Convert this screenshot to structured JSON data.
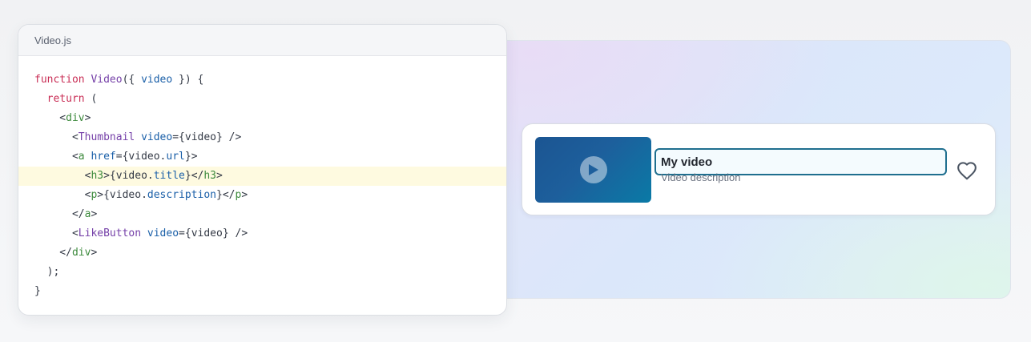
{
  "editor": {
    "filename": "Video.js",
    "highlighted_line": 5,
    "lines": [
      [
        {
          "t": "function ",
          "c": "kw"
        },
        {
          "t": "Video",
          "c": "fn"
        },
        {
          "t": "({ ",
          "c": "plain"
        },
        {
          "t": "video",
          "c": "prop"
        },
        {
          "t": " }) {",
          "c": "plain"
        }
      ],
      [
        {
          "t": "  return ",
          "c": "kw"
        },
        {
          "t": "(",
          "c": "plain"
        }
      ],
      [
        {
          "t": "    <",
          "c": "plain"
        },
        {
          "t": "div",
          "c": "tag"
        },
        {
          "t": ">",
          "c": "plain"
        }
      ],
      [
        {
          "t": "      <",
          "c": "plain"
        },
        {
          "t": "Thumbnail",
          "c": "comp"
        },
        {
          "t": " video",
          "c": "prop"
        },
        {
          "t": "={video} />",
          "c": "plain"
        }
      ],
      [
        {
          "t": "      <",
          "c": "plain"
        },
        {
          "t": "a",
          "c": "tag"
        },
        {
          "t": " href",
          "c": "prop"
        },
        {
          "t": "={video.",
          "c": "plain"
        },
        {
          "t": "url",
          "c": "prop"
        },
        {
          "t": "}>",
          "c": "plain"
        }
      ],
      [
        {
          "t": "        <",
          "c": "plain"
        },
        {
          "t": "h3",
          "c": "tag"
        },
        {
          "t": ">{video.",
          "c": "plain"
        },
        {
          "t": "title",
          "c": "prop"
        },
        {
          "t": "}</",
          "c": "plain"
        },
        {
          "t": "h3",
          "c": "tag"
        },
        {
          "t": ">",
          "c": "plain"
        }
      ],
      [
        {
          "t": "        <",
          "c": "plain"
        },
        {
          "t": "p",
          "c": "tag"
        },
        {
          "t": ">{video.",
          "c": "plain"
        },
        {
          "t": "description",
          "c": "prop"
        },
        {
          "t": "}</",
          "c": "plain"
        },
        {
          "t": "p",
          "c": "tag"
        },
        {
          "t": ">",
          "c": "plain"
        }
      ],
      [
        {
          "t": "      </",
          "c": "plain"
        },
        {
          "t": "a",
          "c": "tag"
        },
        {
          "t": ">",
          "c": "plain"
        }
      ],
      [
        {
          "t": "      <",
          "c": "plain"
        },
        {
          "t": "LikeButton",
          "c": "comp"
        },
        {
          "t": " video",
          "c": "prop"
        },
        {
          "t": "={video} />",
          "c": "plain"
        }
      ],
      [
        {
          "t": "    </",
          "c": "plain"
        },
        {
          "t": "div",
          "c": "tag"
        },
        {
          "t": ">",
          "c": "plain"
        }
      ],
      [
        {
          "t": "  );",
          "c": "plain"
        }
      ],
      [
        {
          "t": "}",
          "c": "plain"
        }
      ]
    ]
  },
  "preview": {
    "video": {
      "title": "My video",
      "description": "Video description",
      "thumbnail_icon": "play-icon",
      "like_icon": "heart-outline-icon"
    }
  },
  "colors": {
    "keyword": "#c92d55",
    "function": "#7540a8",
    "property": "#1a5fa8",
    "tag": "#3d8a3d",
    "highlight": "#fefae0",
    "title_focus_border": "#1f6f8f",
    "thumbnail": "#1b5592"
  }
}
